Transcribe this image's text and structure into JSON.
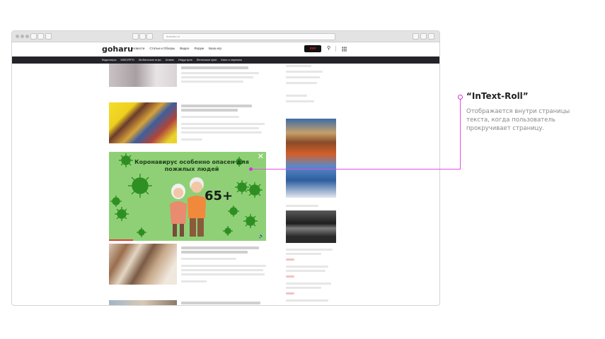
{
  "browser": {
    "url": "dosnaru.ru"
  },
  "site": {
    "logo": "goharu",
    "top_nav": [
      "Новости",
      "Статьи и Обзоры",
      "Видео",
      "Форум",
      "База игр"
    ],
    "sub_nav": [
      "Видеоигры",
      "MMO/RPG",
      "Мобильные игры",
      "Аниме",
      "Индустрия",
      "Железные купи",
      "Кино и сериалы"
    ],
    "brand_badge": "msi"
  },
  "ad": {
    "title": "Коронавирус особенно опасен для пожилых людей",
    "big_text": "65+",
    "close_icon": "close-icon",
    "sound_icon": "speaker-icon"
  },
  "annotation": {
    "title": "“InText-Roll”",
    "description": "Отображается внутри страницы текста, когда пользователь прокручивает страницу."
  },
  "colors": {
    "accent": "#d633d6",
    "ad_background": "#8fd077",
    "nav_dark": "#232329"
  }
}
